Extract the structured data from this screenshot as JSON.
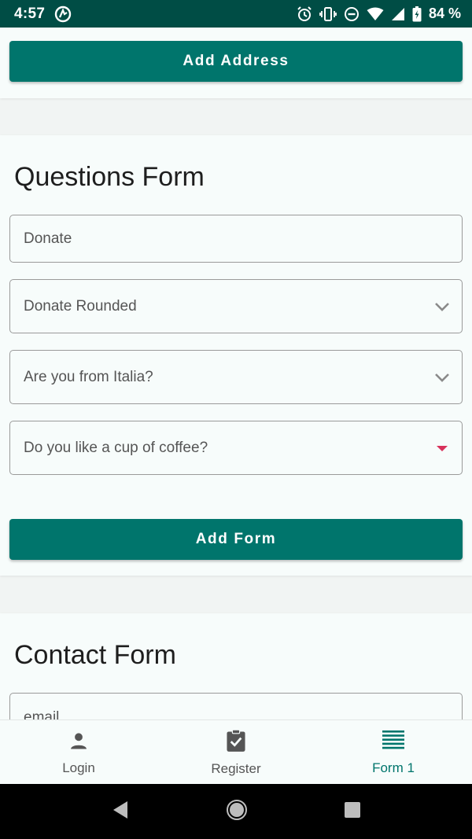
{
  "status_bar": {
    "time": "4:57",
    "battery": "84 %",
    "icons": [
      "app-notification-icon",
      "alarm-icon",
      "vibrate-icon",
      "dnd-icon",
      "wifi-icon",
      "signal-icon",
      "battery-icon"
    ]
  },
  "address_section": {
    "add_button": "Add Address"
  },
  "questions_form": {
    "title": "Questions Form",
    "fields": [
      {
        "label": "Donate",
        "type": "text"
      },
      {
        "label": "Donate Rounded",
        "type": "select"
      },
      {
        "label": "Are you from Italia?",
        "type": "select"
      },
      {
        "label": "Do you like a cup of coffee?",
        "type": "select-triangle"
      }
    ],
    "add_button": "Add Form"
  },
  "contact_form": {
    "title": "Contact Form",
    "email_placeholder": "email"
  },
  "bottom_nav": {
    "items": [
      {
        "label": "Login",
        "icon": "person-icon"
      },
      {
        "label": "Register",
        "icon": "clipboard-check-icon"
      },
      {
        "label": "Form 1",
        "icon": "list-lines-icon",
        "active": true
      }
    ]
  },
  "colors": {
    "status_bar": "#004d45",
    "primary": "#00756c",
    "dropdown_triangle": "#d8315b"
  }
}
